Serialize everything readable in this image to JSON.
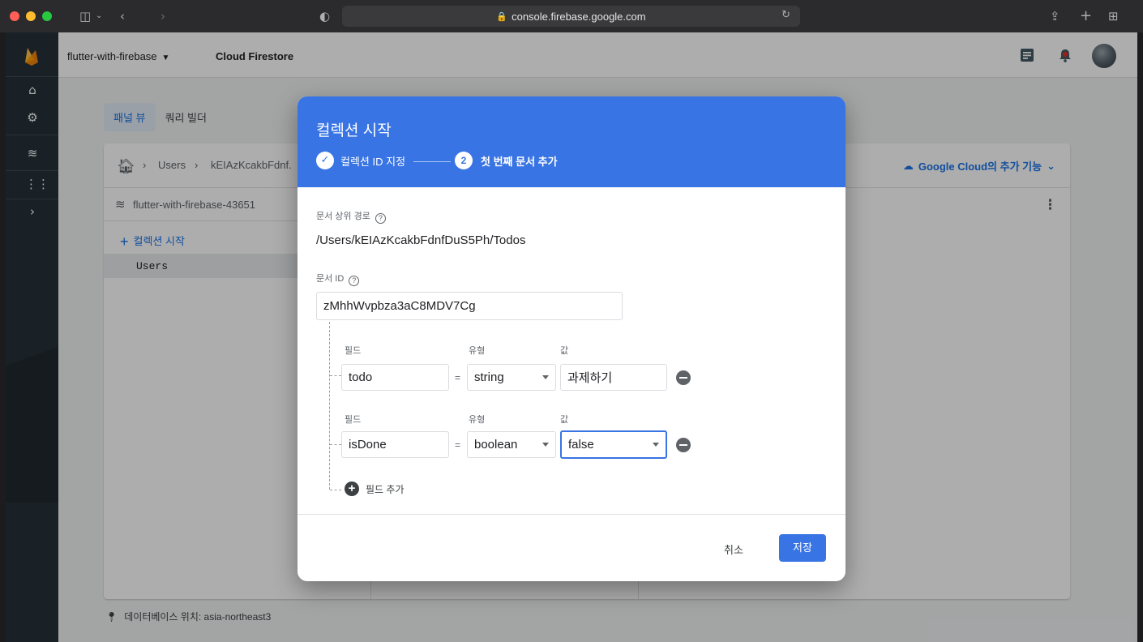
{
  "browser": {
    "url": "console.firebase.google.com"
  },
  "topbar": {
    "project": "flutter-with-firebase",
    "product": "Cloud Firestore"
  },
  "view_tabs": [
    "패널 뷰",
    "쿼리 빌더"
  ],
  "breadcrumb": {
    "items": [
      "Users",
      "kEIAzKcakbFdnf."
    ]
  },
  "google_cloud_extra": "Google Cloud의 추가 기능",
  "panel": {
    "database_name": "flutter-with-firebase-43651",
    "start_collection": "컬렉션 시작",
    "collections": [
      "Users"
    ]
  },
  "footer": {
    "db_location": "데이터베이스 위치: asia-northeast3"
  },
  "dialog": {
    "title": "컬렉션 시작",
    "steps": [
      {
        "label": "컬렉션 ID 지정",
        "done": true
      },
      {
        "number": "2",
        "label": "첫 번째 문서 추가"
      }
    ],
    "parent_path_label": "문서 상위 경로",
    "parent_path": "/Users/kEIAzKcakbFdnfDuS5Ph/Todos",
    "doc_id_label": "문서 ID",
    "doc_id": "zMhhWvpbza3aC8MDV7Cg",
    "field_header": "필드",
    "type_header": "유형",
    "value_header": "값",
    "fields": [
      {
        "name": "todo",
        "type": "string",
        "value": "과제하기"
      },
      {
        "name": "isDone",
        "type": "boolean",
        "value": "false"
      }
    ],
    "add_field": "필드 추가",
    "cancel": "취소",
    "save": "저장"
  },
  "colors": {
    "accent": "#3874e4",
    "rail": "#263238",
    "link": "#1a73e8"
  }
}
